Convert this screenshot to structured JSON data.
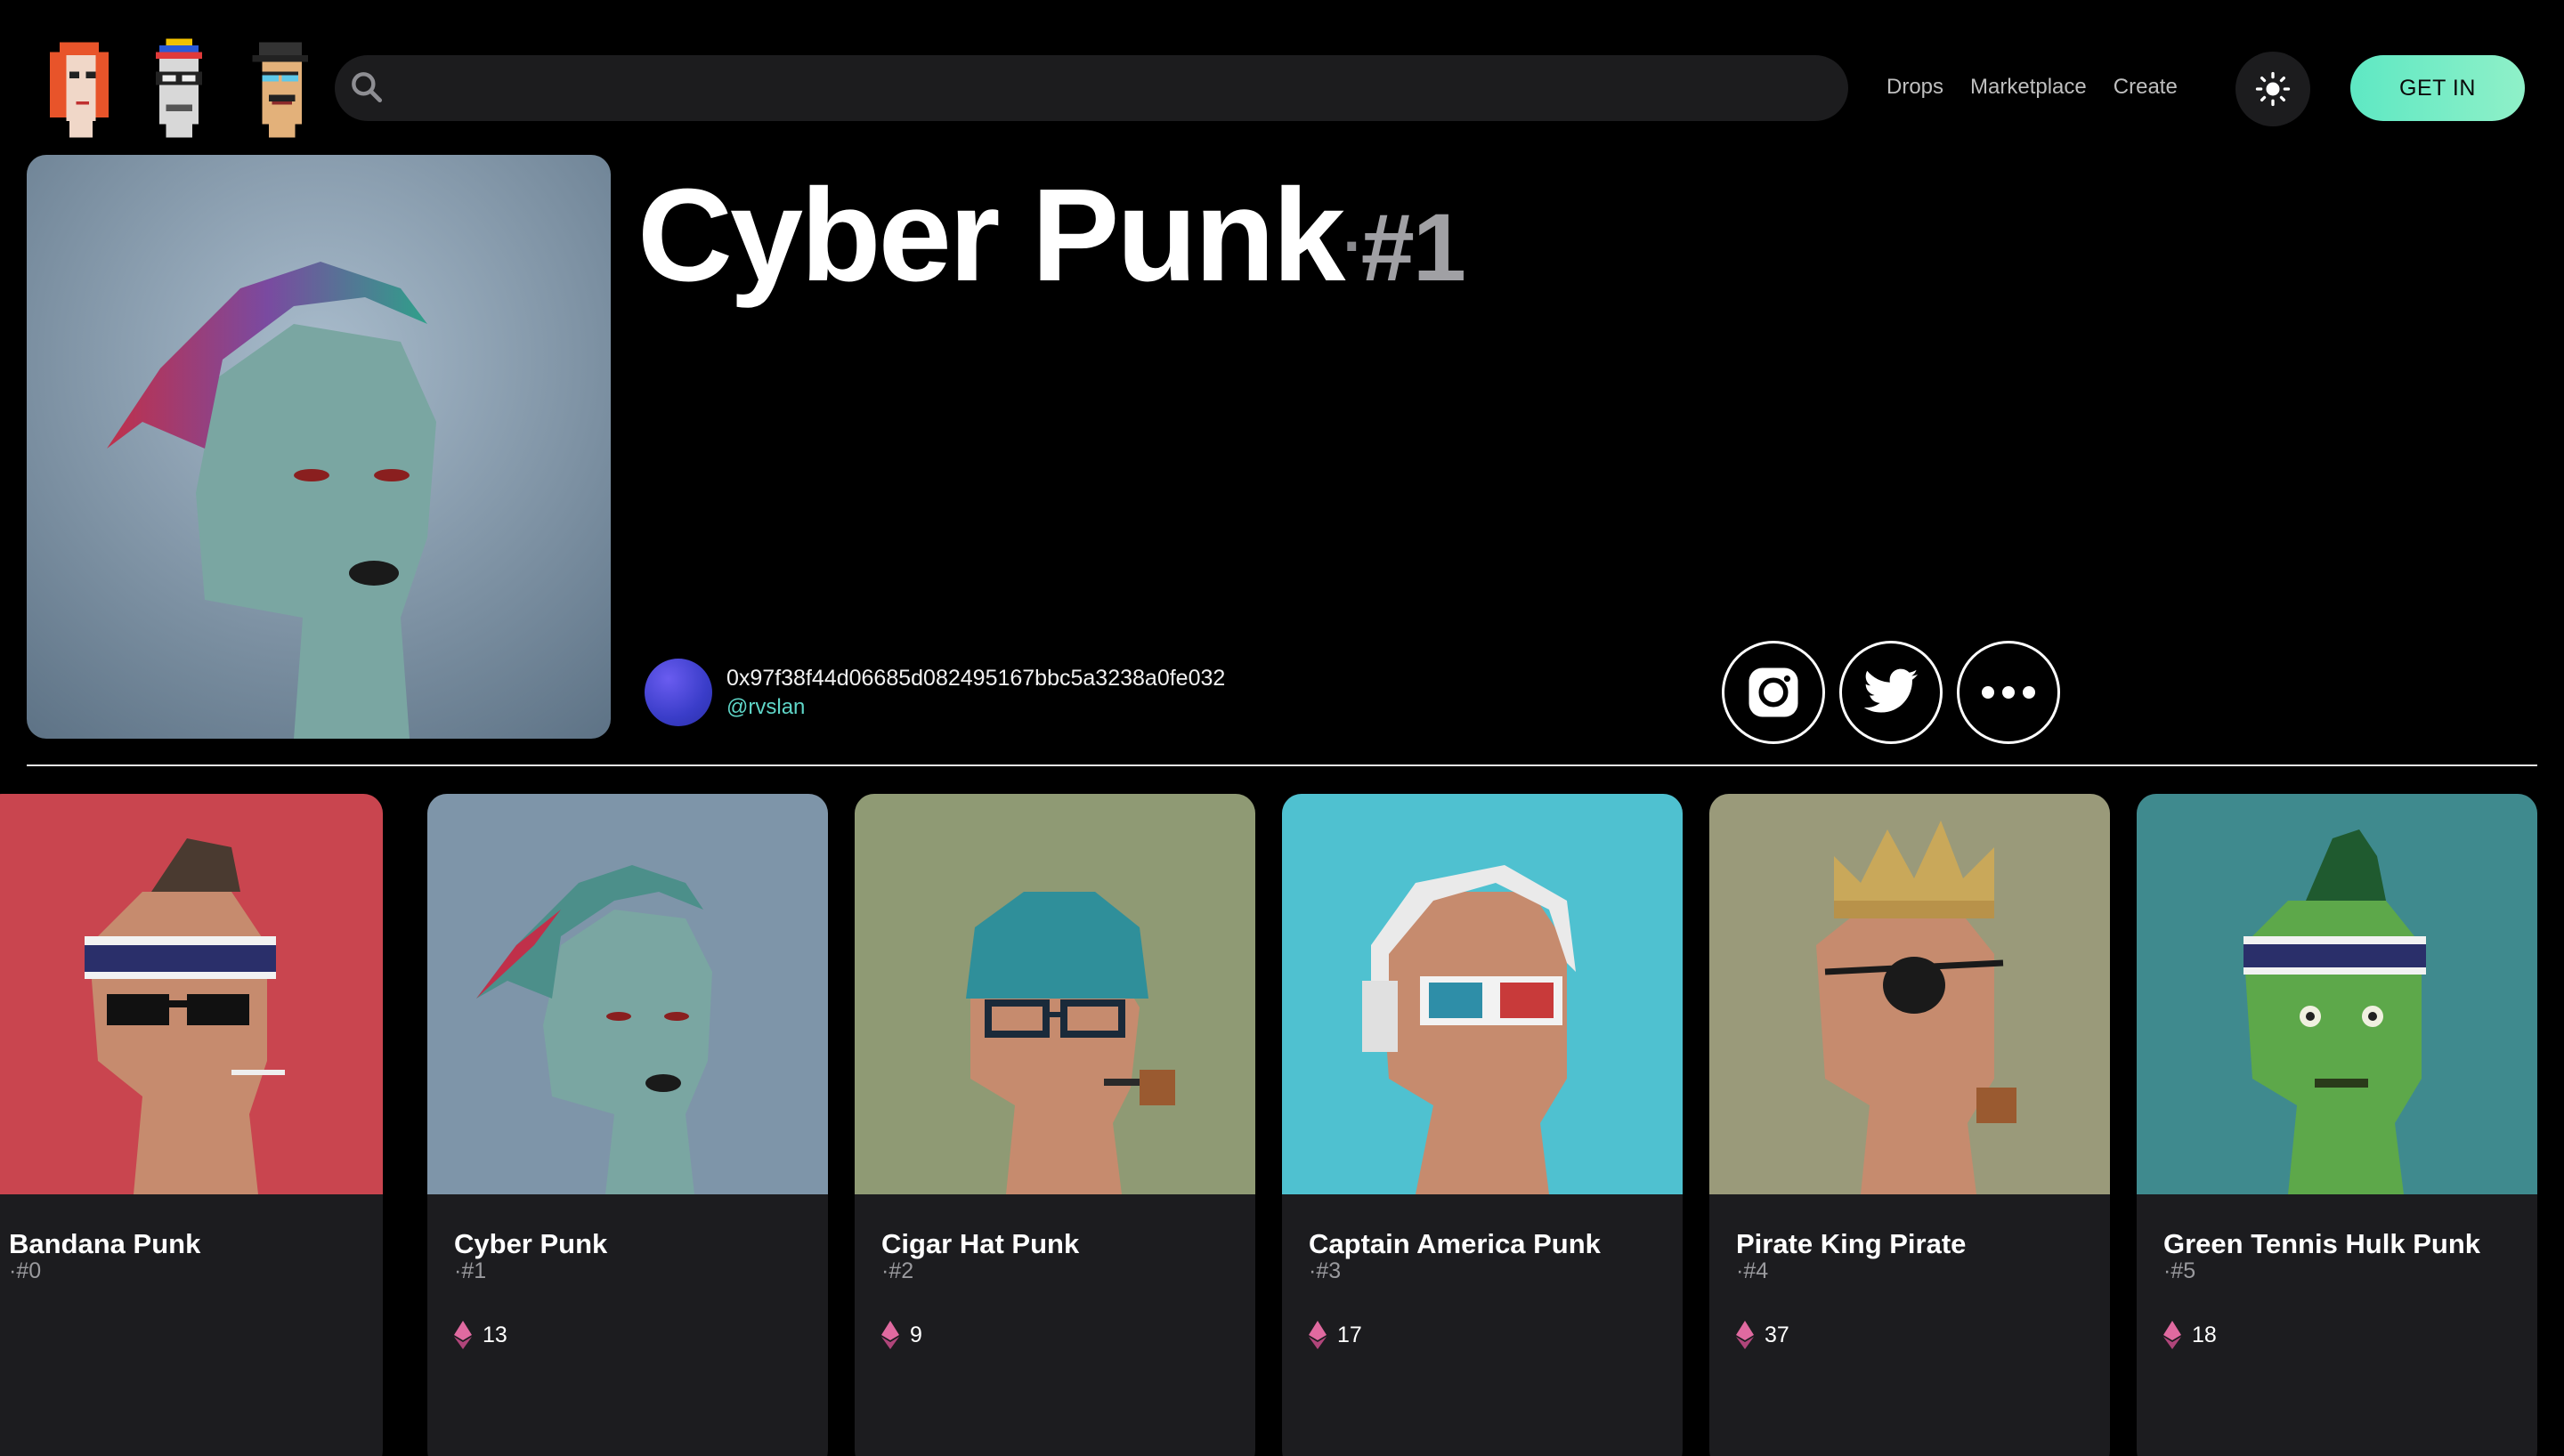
{
  "header": {
    "logos": [
      "punk-logo-red",
      "punk-logo-blue-cap",
      "punk-logo-gray-cap"
    ],
    "search": {
      "placeholder": "",
      "value": ""
    },
    "nav": [
      "Drops",
      "Marketplace",
      "Create"
    ],
    "theme_icon": "sun-icon",
    "cta": "GET IN"
  },
  "hero": {
    "title": "Cyber Punk",
    "separator": "·",
    "number": "#1",
    "owner_address": "0x97f38f44d06685d082495167bbc5a3238a0fe032",
    "owner_handle": "@rvslan",
    "socials": [
      "instagram-icon",
      "twitter-icon",
      "more-icon"
    ]
  },
  "cards": [
    {
      "name": "Bandana Punk",
      "id": "·#0",
      "price": ""
    },
    {
      "name": "Cyber Punk",
      "id": "·#1",
      "price": "13"
    },
    {
      "name": "Cigar Hat Punk",
      "id": "·#2",
      "price": "9"
    },
    {
      "name": "Captain America Punk",
      "id": "·#3",
      "price": "17"
    },
    {
      "name": "Pirate King Pirate",
      "id": "·#4",
      "price": "37"
    },
    {
      "name": "Green Tennis Hulk Punk",
      "id": "·#5",
      "price": "18"
    }
  ],
  "colors": {
    "accent": "#5ee8c3",
    "background": "#000000",
    "card": "#1c1c1f",
    "handle": "#5fd6c8",
    "eth": "#e06aa0"
  }
}
